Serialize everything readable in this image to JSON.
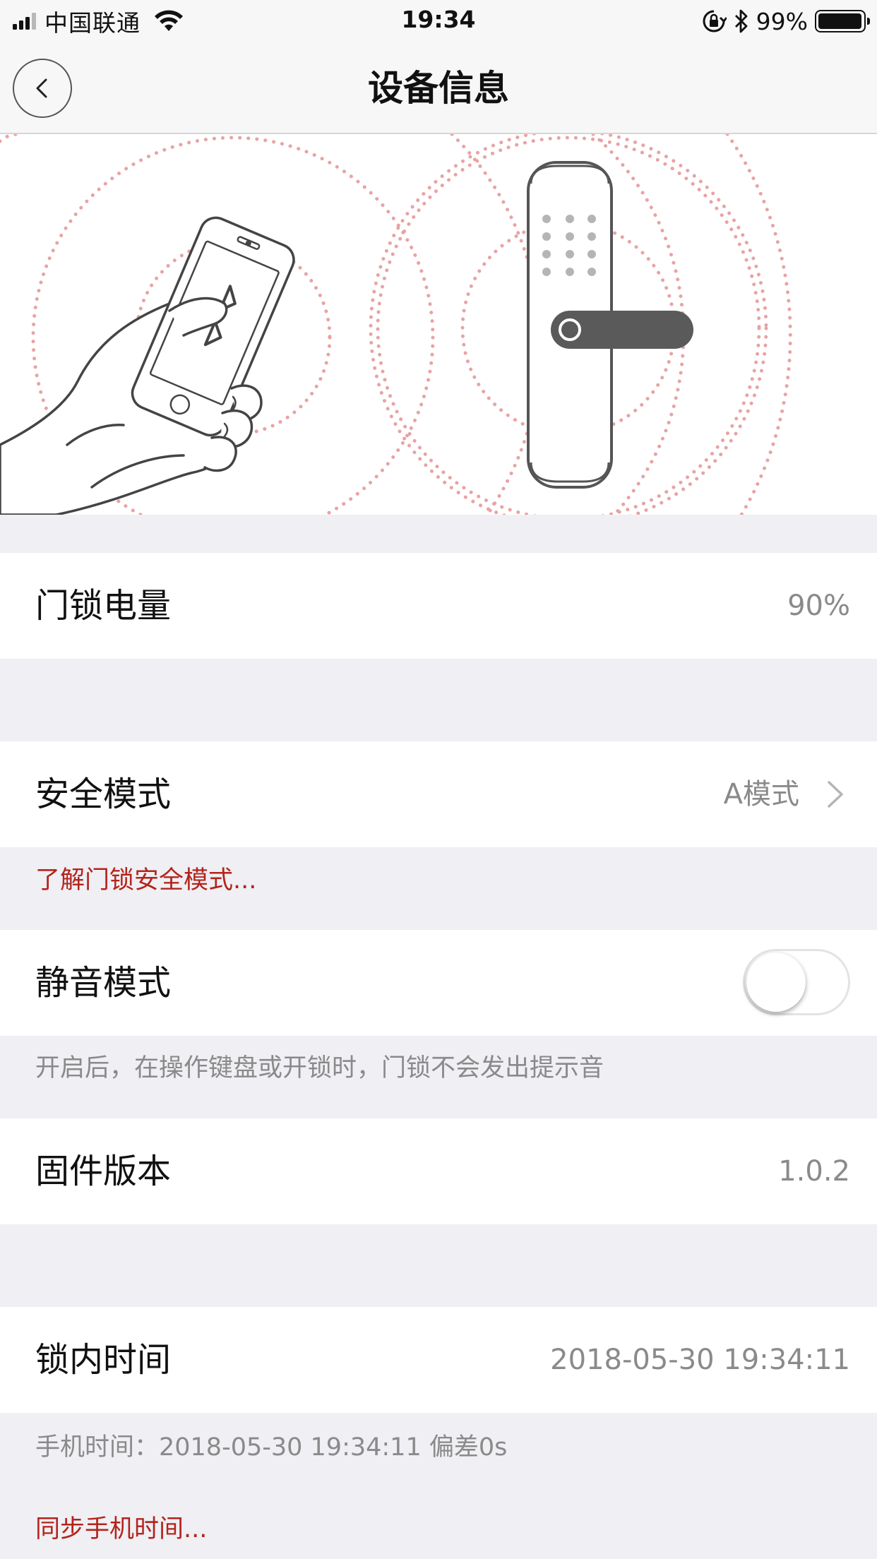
{
  "status_bar": {
    "carrier": "中国联通",
    "time": "19:34",
    "battery_percent": "99%",
    "battery_level": 0.99,
    "icons": [
      "signal-icon",
      "wifi-icon",
      "orientation-lock-icon",
      "bluetooth-icon",
      "battery-icon"
    ]
  },
  "nav": {
    "title": "设备信息",
    "back_icon": "chevron-left-icon"
  },
  "hero": {
    "illustration": "phone-bluetooth-to-door-lock",
    "accent_color": "#e8a3a3"
  },
  "rows": {
    "battery": {
      "label": "门锁电量",
      "value": "90%"
    },
    "security": {
      "label": "安全模式",
      "value": "A模式",
      "link": "了解门锁安全模式..."
    },
    "mute": {
      "label": "静音模式",
      "on": false,
      "note": "开启后，在操作键盘或开锁时，门锁不会发出提示音"
    },
    "firmware": {
      "label": "固件版本",
      "value": "1.0.2"
    },
    "lock_time": {
      "label": "锁内时间",
      "value": "2018-05-30 19:34:11",
      "phone_time": "手机时间：2018-05-30 19:34:11 偏差0s",
      "sync_link": "同步手机时间..."
    }
  },
  "colors": {
    "link_red": "#b3241b",
    "background": "#efeff4",
    "value_gray": "#8a8a8a"
  }
}
